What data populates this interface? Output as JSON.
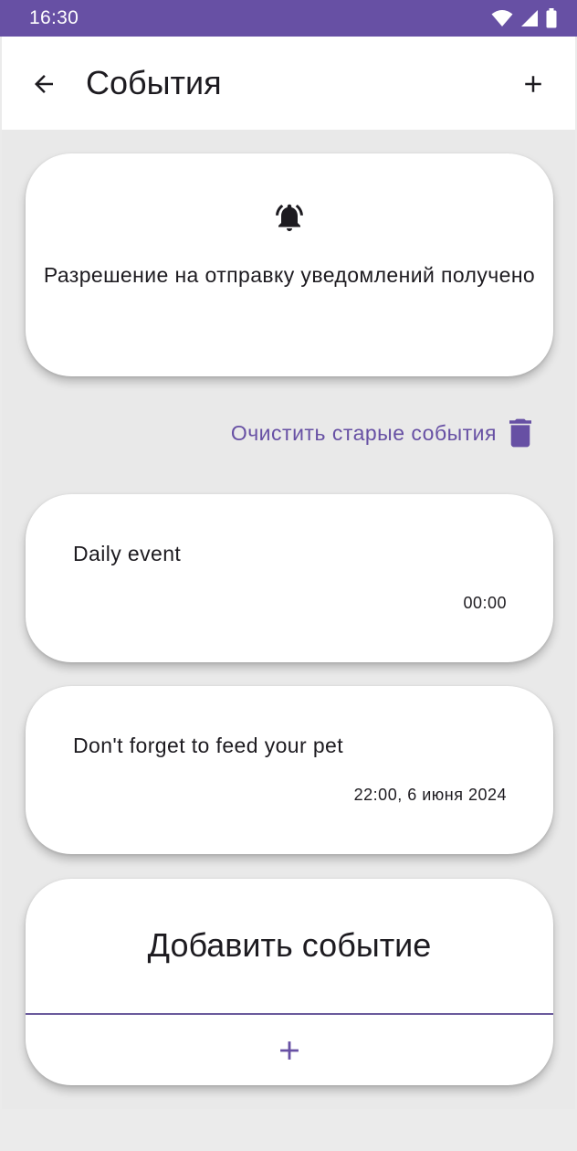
{
  "status_bar": {
    "time": "16:30",
    "icons": [
      "wifi-icon",
      "signal-icon",
      "battery-icon"
    ]
  },
  "app_bar": {
    "title": "События",
    "back_icon": "arrow-left-icon",
    "add_icon": "plus-icon"
  },
  "permission_card": {
    "icon": "bell-ring-icon",
    "text": "Разрешение на отправку уведомлений получено"
  },
  "clear_action": {
    "label": "Очистить старые события",
    "icon": "trash-icon"
  },
  "events": [
    {
      "title": "Daily event",
      "time": "00:00"
    },
    {
      "title": "Don't forget to feed your pet",
      "time": "22:00, 6 июня 2024"
    }
  ],
  "add_card": {
    "title": "Добавить событие",
    "icon": "plus-icon"
  },
  "colors": {
    "accent": "#6750a4",
    "status_bar": "#6750a4",
    "background": "#e9e9e9",
    "surface": "#ffffff",
    "text": "#1d1b20"
  }
}
